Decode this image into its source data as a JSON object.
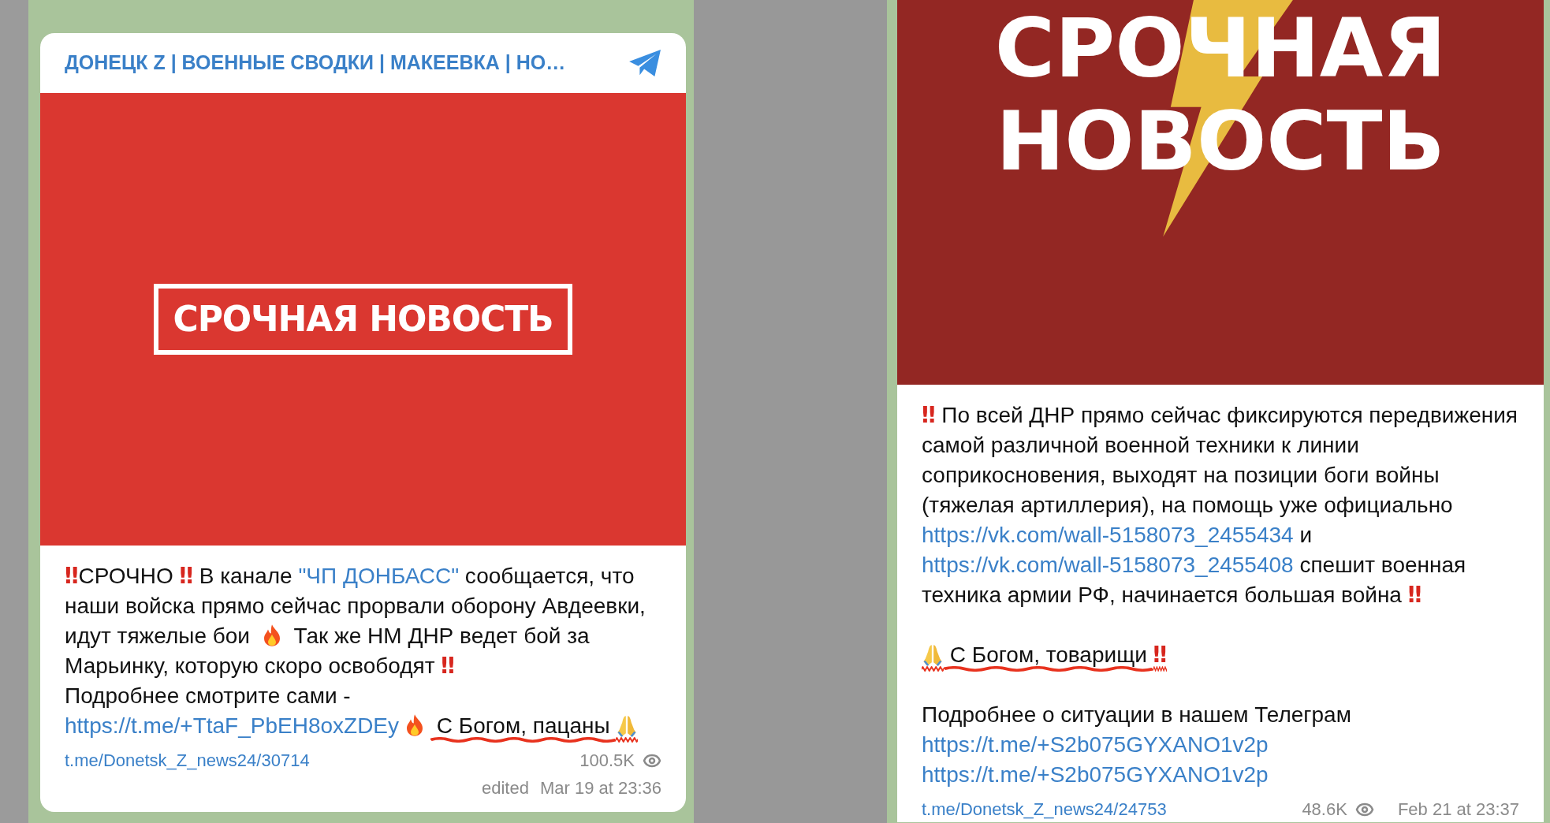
{
  "posts": [
    {
      "channel_title": "ДОНЕЦК Z | ВОЕННЫЕ СВОДКИ | МАКЕЕВКА | НО…",
      "image": {
        "kind": "boxed",
        "lines": [
          "СРОЧНАЯ НОВОСТЬ"
        ]
      },
      "paragraphs": [
        [
          {
            "kind": "bang",
            "text": "‼"
          },
          {
            "kind": "text",
            "text": "СРОЧНО "
          },
          {
            "kind": "bang",
            "text": "‼"
          },
          {
            "kind": "text",
            "text": " В канале "
          },
          {
            "kind": "link",
            "text": "\"ЧП ДОНБАСС\""
          },
          {
            "kind": "text",
            "text": " сообщается, что наши войска прямо сейчас прорвали оборону Авдеевки, идут тяжелые бои "
          },
          {
            "kind": "fire"
          },
          {
            "kind": "text",
            "text": " Так же НМ ДНР ведет бой за Марьинку, которую скоро освободят "
          },
          {
            "kind": "bang",
            "text": "‼"
          },
          {
            "kind": "br"
          },
          {
            "kind": "text",
            "text": "Подробнее смотрите сами - "
          },
          {
            "kind": "link",
            "text": "https://t.me/+TtaF_PbEH8oxZDEy"
          },
          {
            "kind": "fire"
          },
          {
            "kind": "text",
            "text": " С Богом, пацаны ",
            "scribbled": true
          },
          {
            "kind": "pray",
            "scribbled": true
          }
        ]
      ],
      "post_link": "t.me/Donetsk_Z_news24/30714",
      "views": "100.5K",
      "edited": "edited",
      "date": "Mar 19 at 23:36"
    },
    {
      "image": {
        "kind": "bolt",
        "lines": [
          "СРОЧНАЯ",
          "НОВОСТЬ"
        ]
      },
      "paragraphs": [
        [
          {
            "kind": "bang",
            "text": "‼"
          },
          {
            "kind": "text",
            "text": " По всей ДНР прямо сейчас фиксируются передвижения самой различной военной техники к линии соприкосновения, выходят на позиции боги войны (тяжелая артиллерия), на помощь уже официально "
          },
          {
            "kind": "link",
            "text": "https://vk.com/wall-5158073_2455434"
          },
          {
            "kind": "text",
            "text": " и "
          },
          {
            "kind": "link",
            "text": "https://vk.com/wall-5158073_2455408"
          },
          {
            "kind": "text",
            "text": " спешит военная техника армии РФ, начинается большая война "
          },
          {
            "kind": "bang",
            "text": "‼"
          }
        ],
        [
          {
            "kind": "pray",
            "scribbled": true
          },
          {
            "kind": "text",
            "text": " С Богом, товарищи ",
            "scribbled": true
          },
          {
            "kind": "bang",
            "text": "‼",
            "scribbled": true
          }
        ],
        [
          {
            "kind": "text",
            "text": "Подробнее о ситуации в нашем Телеграм"
          },
          {
            "kind": "br"
          },
          {
            "kind": "link",
            "text": "https://t.me/+S2b075GYXANO1v2p"
          },
          {
            "kind": "br"
          },
          {
            "kind": "link",
            "text": "https://t.me/+S2b075GYXANO1v2p"
          }
        ]
      ],
      "post_link": "t.me/Donetsk_Z_news24/24753",
      "views": "48.6K",
      "date": "Feb 21 at 23:37"
    }
  ]
}
